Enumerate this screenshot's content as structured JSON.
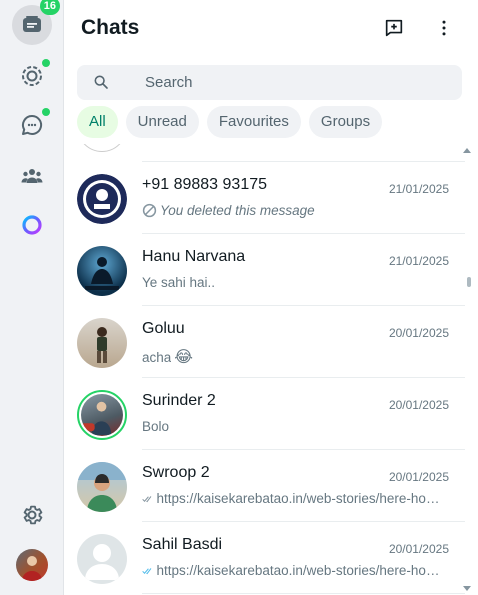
{
  "rail": {
    "chats_badge": "16"
  },
  "header": {
    "title": "Chats"
  },
  "search": {
    "placeholder": "Search"
  },
  "filters": [
    "All",
    "Unread",
    "Favourites",
    "Groups"
  ],
  "chats": [
    {
      "name": "+91 89883 93175",
      "date": "21/01/2025",
      "preview": "You deleted this message",
      "status": "deleted"
    },
    {
      "name": "Hanu Narvana",
      "date": "21/01/2025",
      "preview": "Ye sahi hai..",
      "status": "none"
    },
    {
      "name": "Goluu",
      "date": "20/01/2025",
      "preview": "acha",
      "preview_emoji": "😂",
      "status": "none"
    },
    {
      "name": "Surinder 2",
      "date": "20/01/2025",
      "preview": "Bolo",
      "status": "none"
    },
    {
      "name": "Swroop 2",
      "date": "20/01/2025",
      "preview": "https://kaisekarebatao.in/web-stories/here-how-to-download-youtube-videos",
      "status": "delivered"
    },
    {
      "name": "Sahil Basdi",
      "date": "20/01/2025",
      "preview": "https://kaisekarebatao.in/web-stories/here-how-to-download-youtube-videos",
      "status": "read"
    }
  ],
  "colors": {
    "accent": "#25d366",
    "active_chip_bg": "#e7fce3",
    "active_chip_text": "#008069",
    "read_tick": "#53bdeb",
    "delivered_tick": "#8696a0"
  }
}
